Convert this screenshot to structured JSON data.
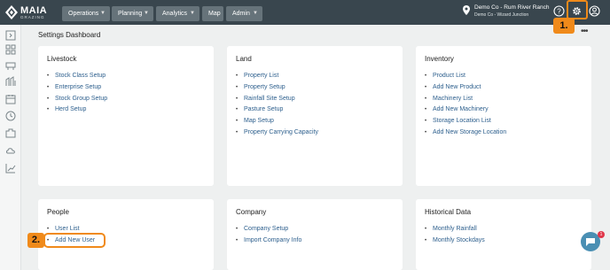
{
  "header": {
    "logo": {
      "name": "MAIA",
      "tagline": "GRAZING"
    },
    "nav": [
      {
        "label": "Operations",
        "has_dropdown": true
      },
      {
        "label": "Planning",
        "has_dropdown": true
      },
      {
        "label": "Analytics",
        "has_dropdown": true
      },
      {
        "label": "Map",
        "has_dropdown": false
      },
      {
        "label": "Admin",
        "has_dropdown": true
      }
    ],
    "location": {
      "line1": "Demo Co - Rum River Ranch",
      "line2": "Demo Co - Wizard Junction",
      "icon": "map-pin-icon"
    },
    "icons": [
      "help-icon",
      "settings-icon",
      "user-icon"
    ]
  },
  "sidebar": {
    "icons": [
      "collapse-icon",
      "dashboard-icon",
      "livestock-icon",
      "grazing-icon",
      "calendar-icon",
      "clock-icon",
      "inventory-icon",
      "weather-icon",
      "reports-icon"
    ]
  },
  "page": {
    "title": "Settings Dashboard",
    "menu_icon": "•••"
  },
  "cards": [
    {
      "title": "Livestock",
      "items": [
        "Stock Class Setup",
        "Enterprise Setup",
        "Stock Group Setup",
        "Herd Setup"
      ]
    },
    {
      "title": "Land",
      "items": [
        "Property List",
        "Property Setup",
        "Rainfall Site Setup",
        "Pasture Setup",
        "Map Setup",
        "Property Carrying Capacity"
      ]
    },
    {
      "title": "Inventory",
      "items": [
        "Product List",
        "Add New Product",
        "Machinery List",
        "Add New Machinery",
        "Storage Location List",
        "Add New Storage Location"
      ]
    },
    {
      "title": "People",
      "items": [
        "User List",
        "Add New User"
      ]
    },
    {
      "title": "Company",
      "items": [
        "Company Setup",
        "Import Company Info"
      ]
    },
    {
      "title": "Historical Data",
      "items": [
        "Monthly Rainfall",
        "Monthly Stockdays"
      ]
    }
  ],
  "callouts": [
    {
      "label": "1.",
      "target": "settings-icon"
    },
    {
      "label": "2.",
      "target": "Add New User"
    }
  ],
  "chat": {
    "badge": "1"
  },
  "colors": {
    "header_bg": "#39464e",
    "nav_btn": "#66737a",
    "link": "#2d5f8d",
    "callout": "#f08a1a",
    "chat": "#4a8fb3"
  }
}
